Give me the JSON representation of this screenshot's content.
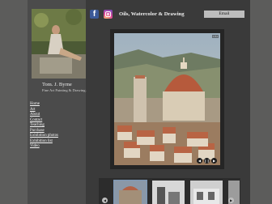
{
  "artist": {
    "name": "Tom. J. Byrne",
    "tagline": "Fine Art Painting & Drawing."
  },
  "nav": [
    "Home",
    "Art",
    "About",
    "Contact",
    "Teaching",
    "Purchase",
    "Exhibition photos",
    "Exhibition list",
    "Video"
  ],
  "header": {
    "title": "Oils, Watercolor & Drawing",
    "email_label": "Email",
    "social": [
      "facebook-icon",
      "instagram-icon"
    ]
  },
  "gallery": {
    "counter": "1/31",
    "controls": [
      "previous",
      "pause",
      "next"
    ],
    "thumbnail_count": 4
  },
  "colors": {
    "page_background": "#5c5c5b",
    "content_background": "#3a3a3a",
    "sidebar_background": "#4b4b4b",
    "email_button": "#bdbdbd"
  }
}
